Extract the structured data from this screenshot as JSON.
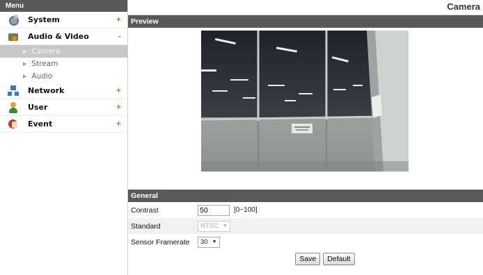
{
  "sidebar": {
    "header": "Menu",
    "items": [
      {
        "label": "System",
        "toggle": "+"
      },
      {
        "label": "Audio & Video",
        "toggle": "-"
      },
      {
        "label": "Network",
        "toggle": "+"
      },
      {
        "label": "User",
        "toggle": "+"
      },
      {
        "label": "Event",
        "toggle": "+"
      }
    ],
    "sub_items": [
      {
        "label": "Camera",
        "arrow": "▶"
      },
      {
        "label": "Stream",
        "arrow": "▶"
      },
      {
        "label": "Audio",
        "arrow": "▶"
      }
    ]
  },
  "main": {
    "title": "Camera",
    "preview_header": "Preview",
    "general_header": "General",
    "fields": {
      "contrast_label": "Contrast",
      "contrast_value": "50",
      "contrast_range": "[0~100]",
      "standard_label": "Standard",
      "standard_value": "NTSC",
      "framerate_label": "Sensor Framerate",
      "framerate_value": "30",
      "caret": "▼"
    },
    "buttons": {
      "save": "Save",
      "default": "Default"
    }
  }
}
